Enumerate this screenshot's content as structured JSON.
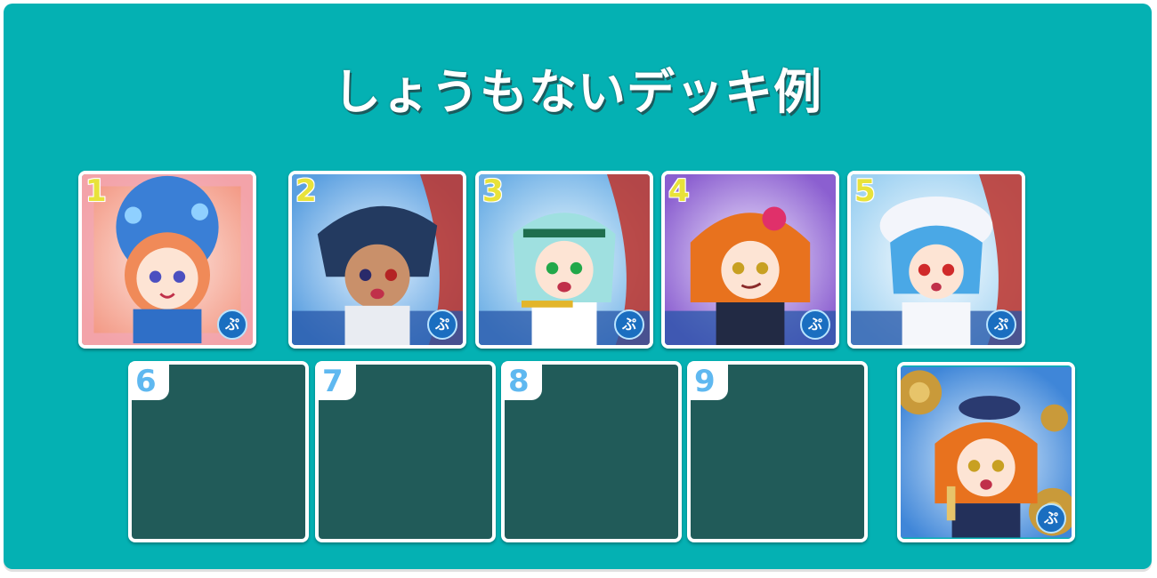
{
  "title": "しょうもないデッキ例",
  "deck": {
    "filled": [
      {
        "slot": "1",
        "frame": "red-pink",
        "hair_color": "#f08a58",
        "bg_color": "#f6b6a0"
      },
      {
        "slot": "2",
        "frame": "blue-red",
        "hair_color": "#233a60",
        "bg_color": "#8dc6f2"
      },
      {
        "slot": "3",
        "frame": "blue-red",
        "hair_color": "#9fe0e0",
        "bg_color": "#8dc6f2"
      },
      {
        "slot": "4",
        "frame": "blue-purple",
        "hair_color": "#e8721e",
        "bg_color": "#b58ce0"
      },
      {
        "slot": "5",
        "frame": "blue-red",
        "hair_color": "#4aa8e6",
        "bg_color": "#d6ecf7"
      }
    ],
    "empty": [
      {
        "slot": "6"
      },
      {
        "slot": "7"
      },
      {
        "slot": "8"
      },
      {
        "slot": "9"
      }
    ],
    "leader_card": {
      "frame": "gold-blue",
      "hair_color": "#e8721e",
      "bg_color": "#6fb5e9"
    }
  },
  "colors": {
    "panel_bg": "#04b1b3",
    "empty_slot_bg": "#215b59",
    "number_yellow": "#e8e23a",
    "number_blue": "#5fb8f0"
  }
}
